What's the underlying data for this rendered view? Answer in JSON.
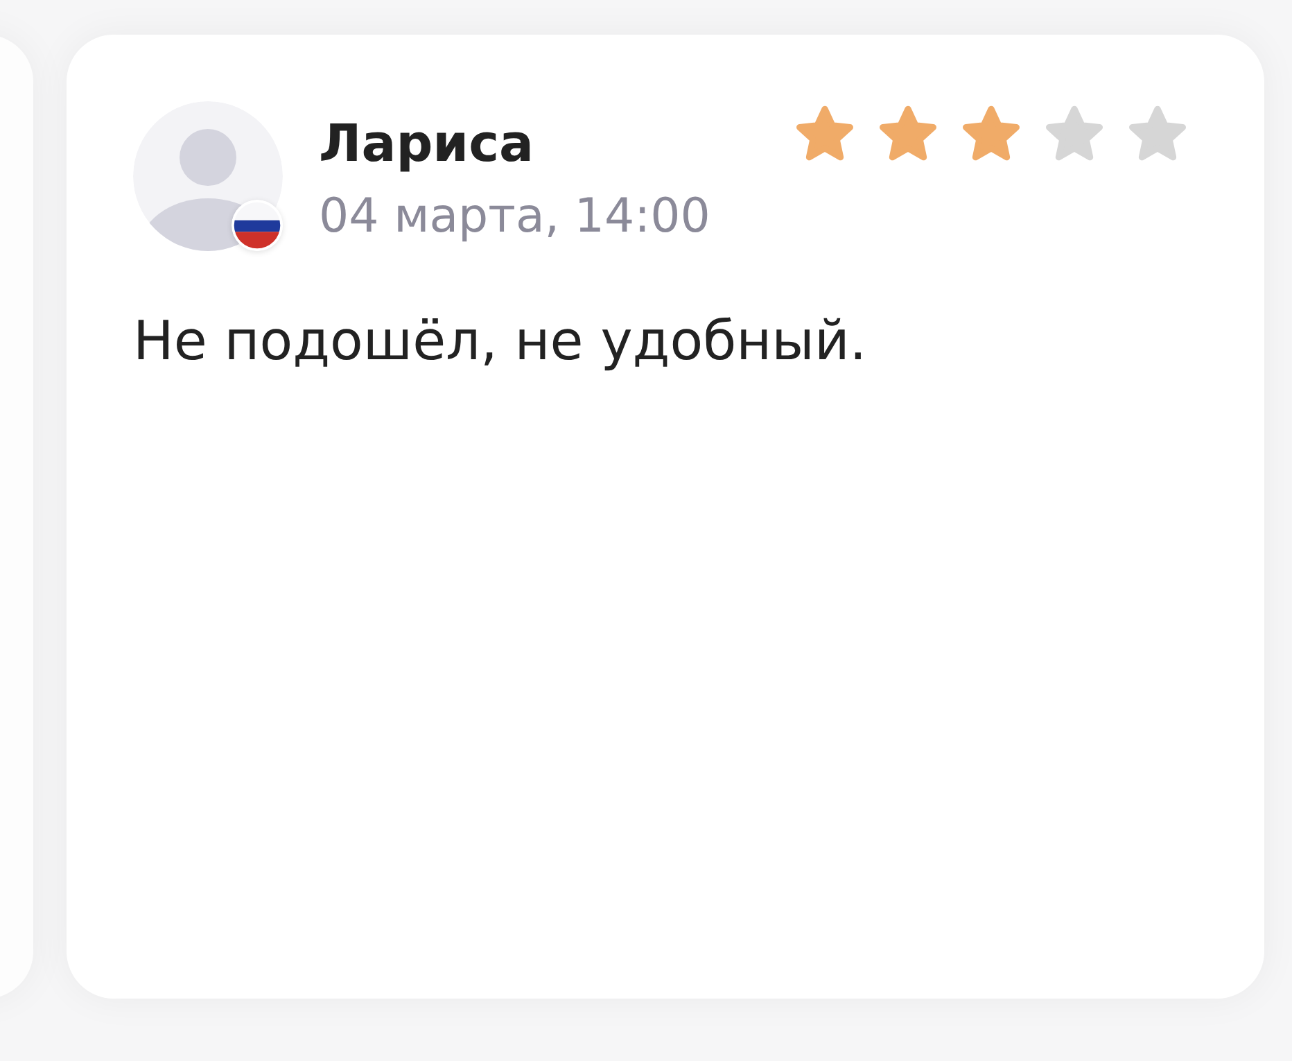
{
  "review": {
    "author": "Лариса",
    "date": "04 марта, 14:00",
    "stars": 3,
    "text": "Не подошёл, не удобный."
  }
}
